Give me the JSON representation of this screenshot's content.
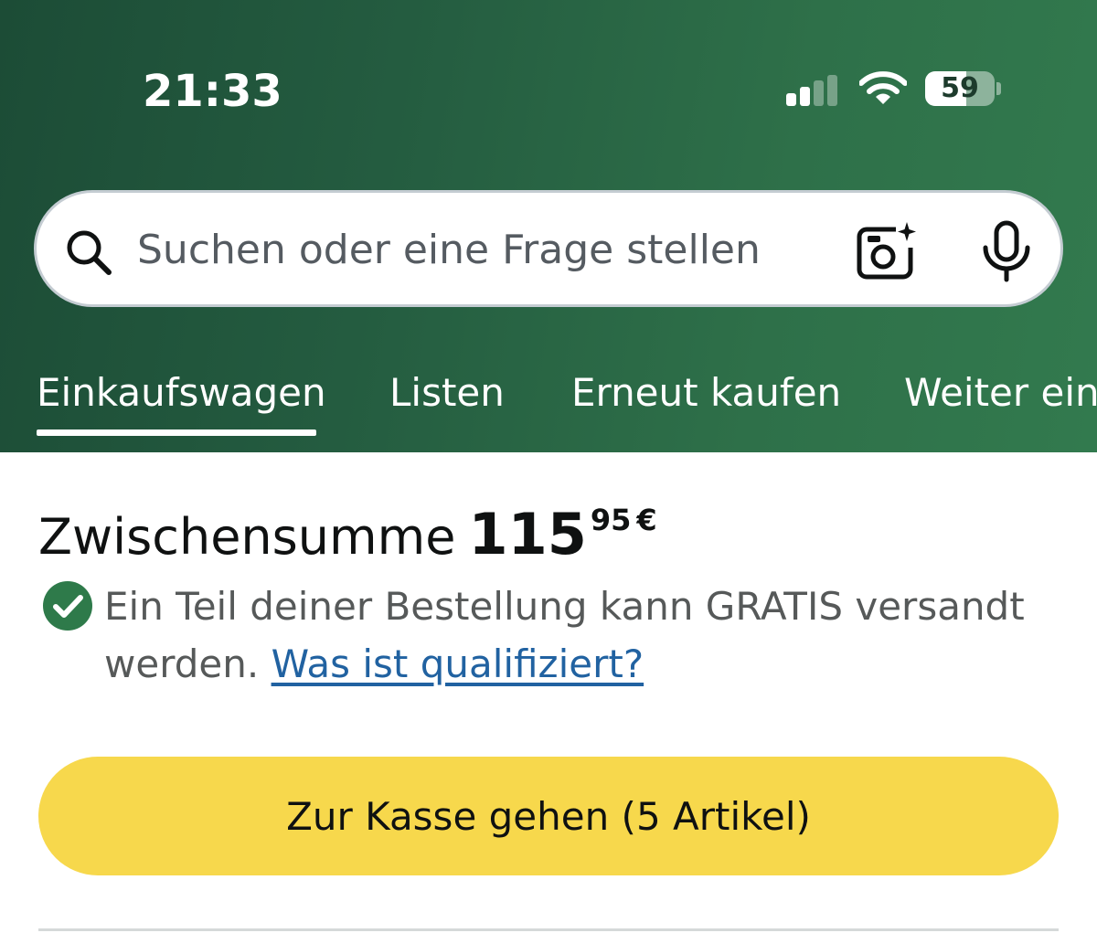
{
  "status_bar": {
    "time": "21:33",
    "battery": "59",
    "battery_level": 0.59,
    "signal_bars_active": 2,
    "signal_bars_total": 4
  },
  "search": {
    "placeholder": "Suchen oder eine Frage stellen",
    "icons": [
      "search-icon",
      "camera-icon",
      "microphone-icon"
    ]
  },
  "tabs": [
    {
      "label": "Einkaufswagen",
      "active": true
    },
    {
      "label": "Listen",
      "active": false
    },
    {
      "label": "Erneut kaufen",
      "active": false
    },
    {
      "label": "Weiter einkaufen",
      "active": false
    }
  ],
  "subtotal": {
    "label": "Zwischensumme",
    "whole": "115",
    "fraction": "95",
    "currency": "€"
  },
  "shipping": {
    "text": "Ein Teil deiner Bestellung kann GRATIS versandt werden.",
    "link": "Was ist qualifiziert?"
  },
  "checkout": {
    "label": "Zur Kasse gehen (5 Artikel)"
  },
  "colors": {
    "header_start": "#1c4c36",
    "header_end": "#327a4e",
    "checkout_button": "#f7d84c",
    "link": "#2162a1",
    "check_green": "#2e7a4a"
  }
}
